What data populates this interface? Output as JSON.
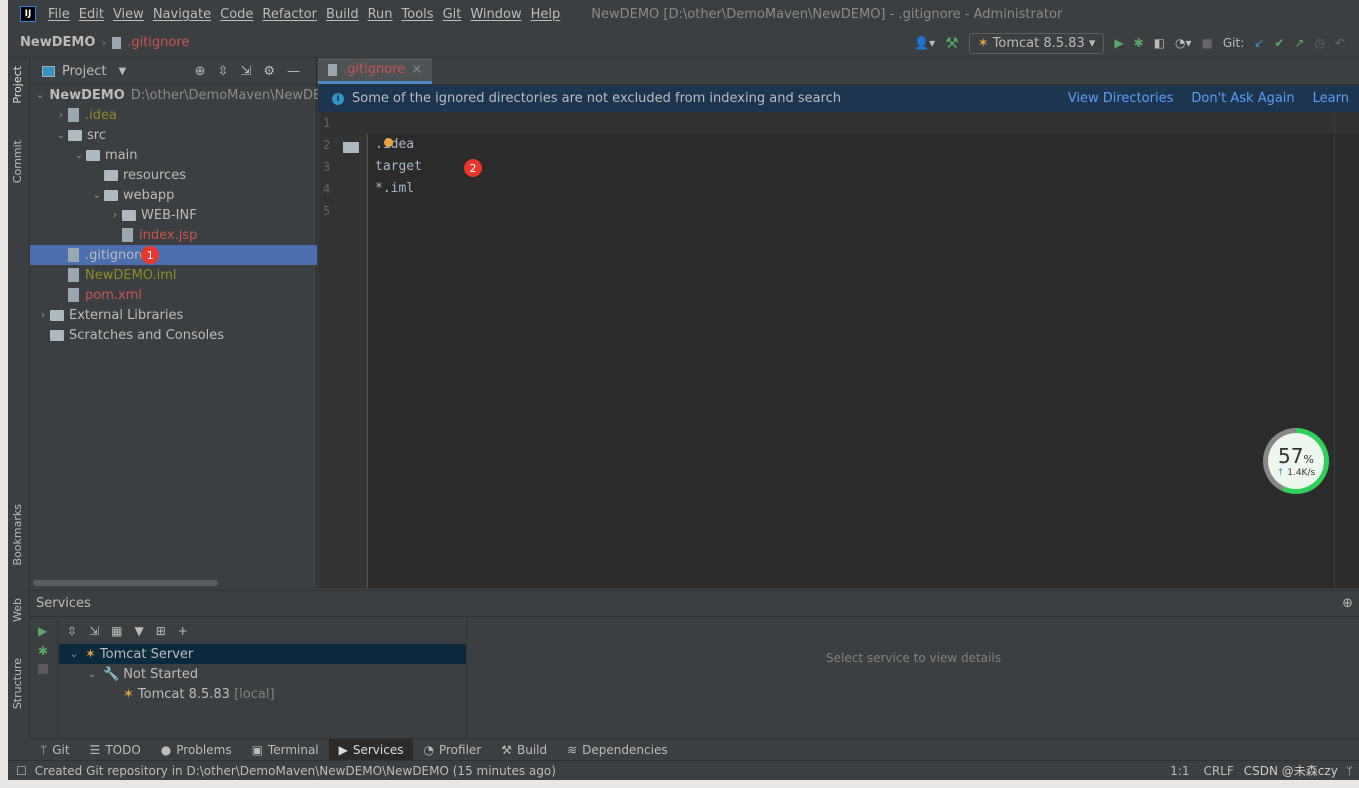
{
  "menubar": {
    "logo": "IJ",
    "items": [
      "File",
      "Edit",
      "View",
      "Navigate",
      "Code",
      "Refactor",
      "Build",
      "Run",
      "Tools",
      "Git",
      "Window",
      "Help"
    ],
    "title": "NewDEMO [D:\\other\\DemoMaven\\NewDEMO] - .gitignore - Administrator"
  },
  "navbar": {
    "project": "NewDEMO",
    "file": ".gitignore",
    "run_config": "Tomcat 8.5.83",
    "git_label": "Git:"
  },
  "sidestrip": {
    "project": "Project",
    "commit": "Commit",
    "bookmarks": "Bookmarks",
    "web": "Web",
    "structure": "Structure"
  },
  "project": {
    "title": "Project",
    "tree": [
      {
        "label": "NewDEMO",
        "extra": "D:\\other\\DemoMaven\\NewDEMO",
        "depth": 0,
        "arrow": "down",
        "color": "#bbbbbb"
      },
      {
        "label": ".idea",
        "depth": 1,
        "arrow": "right",
        "color": "#8c8c26"
      },
      {
        "label": "src",
        "depth": 1,
        "arrow": "down",
        "color": "#bbbbbb"
      },
      {
        "label": "main",
        "depth": 2,
        "arrow": "down",
        "color": "#bbbbbb"
      },
      {
        "label": "resources",
        "depth": 3,
        "arrow": "",
        "color": "#bbbbbb"
      },
      {
        "label": "webapp",
        "depth": 3,
        "arrow": "down",
        "color": "#bbbbbb"
      },
      {
        "label": "WEB-INF",
        "depth": 4,
        "arrow": "right",
        "color": "#bbbbbb"
      },
      {
        "label": "index.jsp",
        "depth": 4,
        "arrow": "",
        "color": "#c75450"
      },
      {
        "label": ".gitignore",
        "depth": 1,
        "arrow": "",
        "color": "#bbbbbb",
        "selected": true,
        "badge": "1"
      },
      {
        "label": "NewDEMO.iml",
        "depth": 1,
        "arrow": "",
        "color": "#8c8c26"
      },
      {
        "label": "pom.xml",
        "depth": 1,
        "arrow": "",
        "color": "#c75450"
      },
      {
        "label": "External Libraries",
        "depth": 0,
        "arrow": "right",
        "color": "#bbbbbb"
      },
      {
        "label": "Scratches and Consoles",
        "depth": 0,
        "arrow": "",
        "color": "#bbbbbb"
      }
    ]
  },
  "editor": {
    "tab": ".gitignore",
    "banner": "Some of the ignored directories are not excluded from indexing and search",
    "links": [
      "View Directories",
      "Don't Ask Again",
      "Learn"
    ],
    "lines": [
      "",
      ".idea",
      "target",
      "*.iml",
      ""
    ],
    "badge": "2"
  },
  "services": {
    "title": "Services",
    "tree": [
      {
        "label": "Tomcat Server"
      },
      {
        "label": "Not Started"
      },
      {
        "label": "Tomcat 8.5.83",
        "suffix": "[local]"
      }
    ],
    "placeholder": "Select service to view details"
  },
  "bottom_tabs": [
    "Git",
    "TODO",
    "Problems",
    "Terminal",
    "Services",
    "Profiler",
    "Build",
    "Dependencies"
  ],
  "status": {
    "message": "Created Git repository in D:\\other\\DemoMaven\\NewDEMO\\NewDEMO (15 minutes ago)",
    "position": "1:1",
    "line_sep": "CRLF",
    "watermark": "CSDN @未森czy"
  },
  "gauge": {
    "percent": "57",
    "unit": "%",
    "speed": "1.4K/s"
  }
}
